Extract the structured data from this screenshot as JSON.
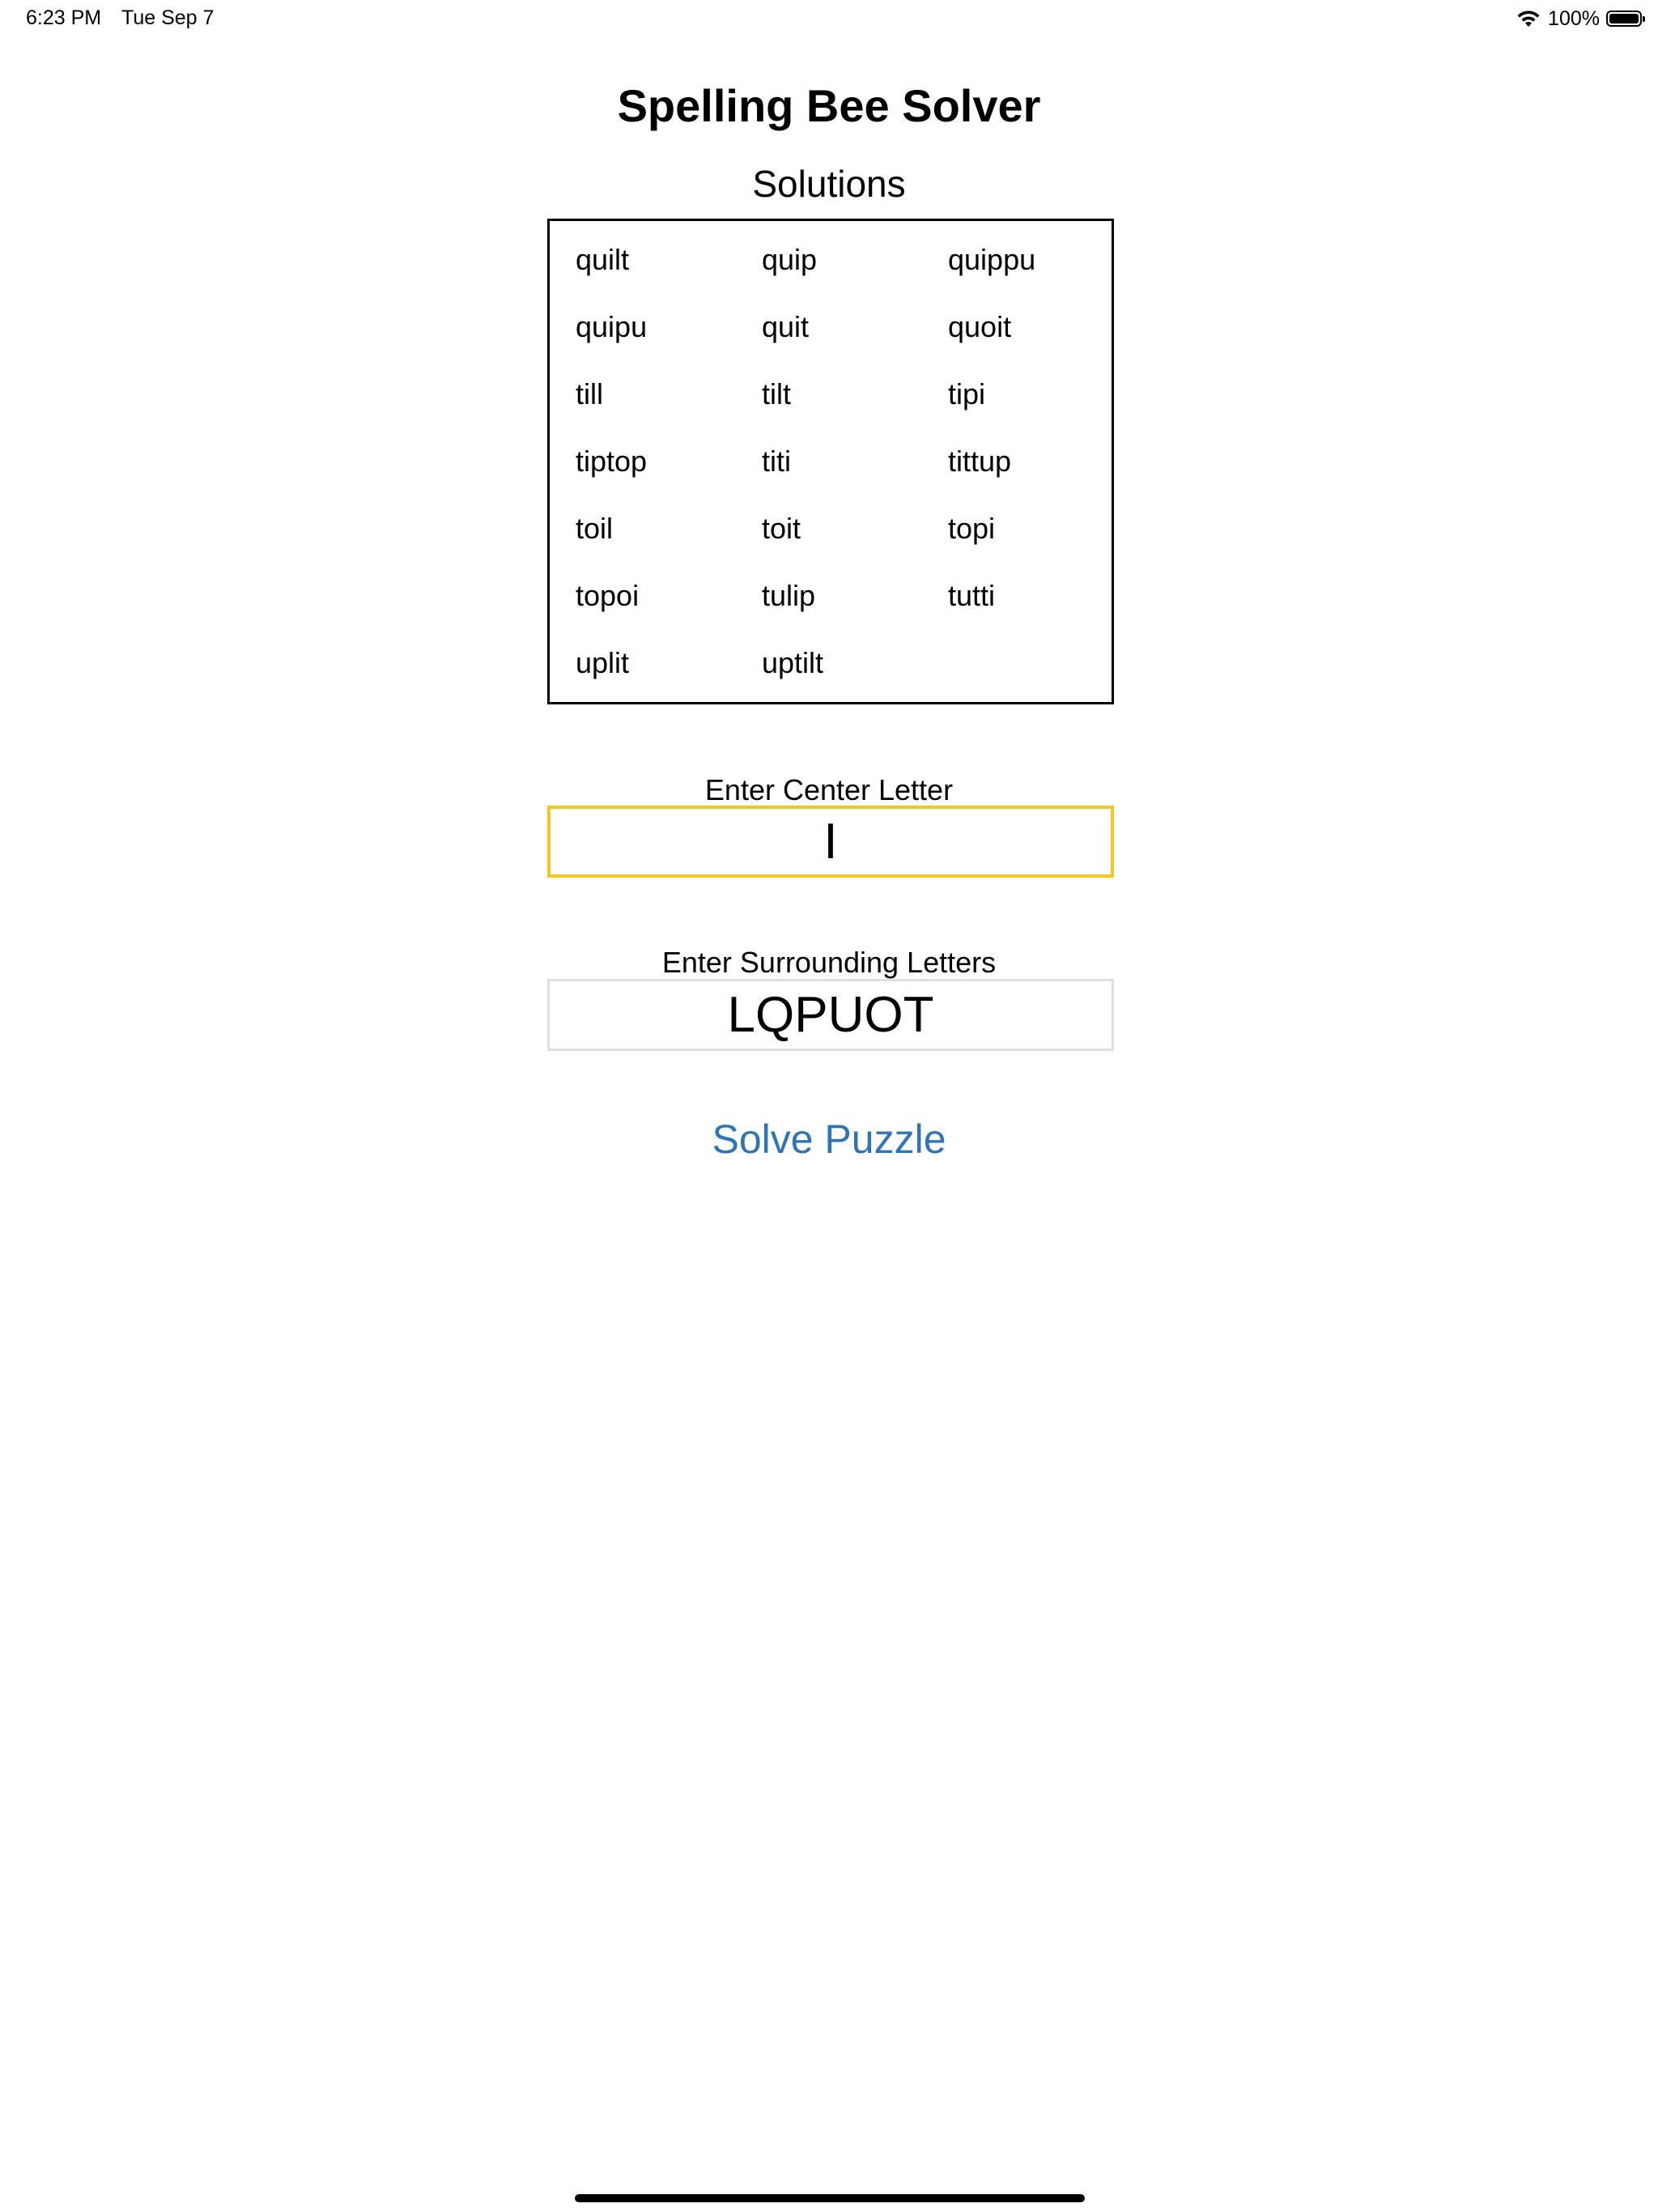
{
  "status_bar": {
    "time": "6:23 PM",
    "date": "Tue Sep 7",
    "battery_text": "100%",
    "battery_level": 1.0,
    "wifi_icon": "wifi-icon",
    "battery_icon": "battery-icon"
  },
  "app": {
    "title": "Spelling Bee Solver",
    "solutions_label": "Solutions",
    "solutions": [
      "quilt",
      "quip",
      "quippu",
      "quipu",
      "quit",
      "quoit",
      "till",
      "tilt",
      "tipi",
      "tiptop",
      "titi",
      "tittup",
      "toil",
      "toit",
      "topi",
      "topoi",
      "tulip",
      "tutti",
      "uplit",
      "uptilt"
    ]
  },
  "center_letter": {
    "label": "Enter Center Letter",
    "value": "I"
  },
  "surrounding_letters": {
    "label": "Enter Surrounding Letters",
    "value": "LQPUOT"
  },
  "solve_button": {
    "label": "Solve Puzzle"
  },
  "colors": {
    "accent": "#2f74b5",
    "focus_border": "#f2c81f",
    "input_border": "#e0e0e0"
  }
}
